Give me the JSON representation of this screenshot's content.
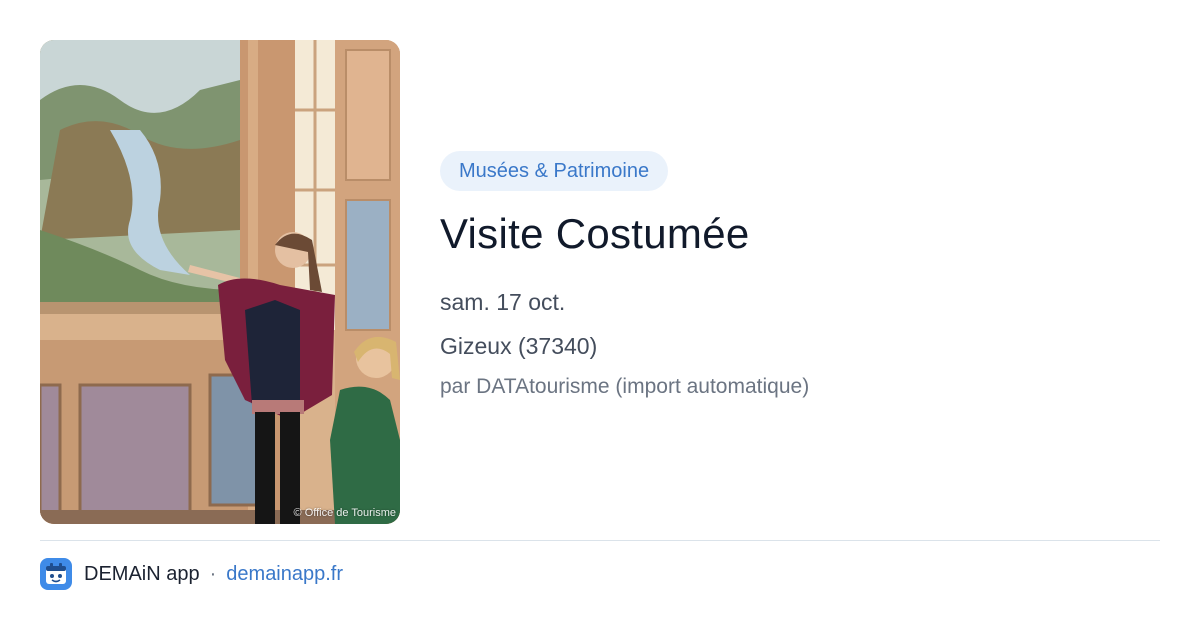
{
  "photo": {
    "credit": "© Office de Tourisme"
  },
  "event": {
    "category": "Musées & Patrimoine",
    "title": "Visite Costumée",
    "date": "sam. 17 oct.",
    "location": "Gizeux (37340)",
    "author": "par DATAtourisme (import automatique)"
  },
  "footer": {
    "app_name": "DEMAiN app",
    "separator": "·",
    "link_text": "demainapp.fr",
    "icon": "calendar-app-icon"
  },
  "colors": {
    "accent": "#3a78c9",
    "badge_bg": "#eaf2fb",
    "app_icon_bg": "#3f8be8"
  }
}
